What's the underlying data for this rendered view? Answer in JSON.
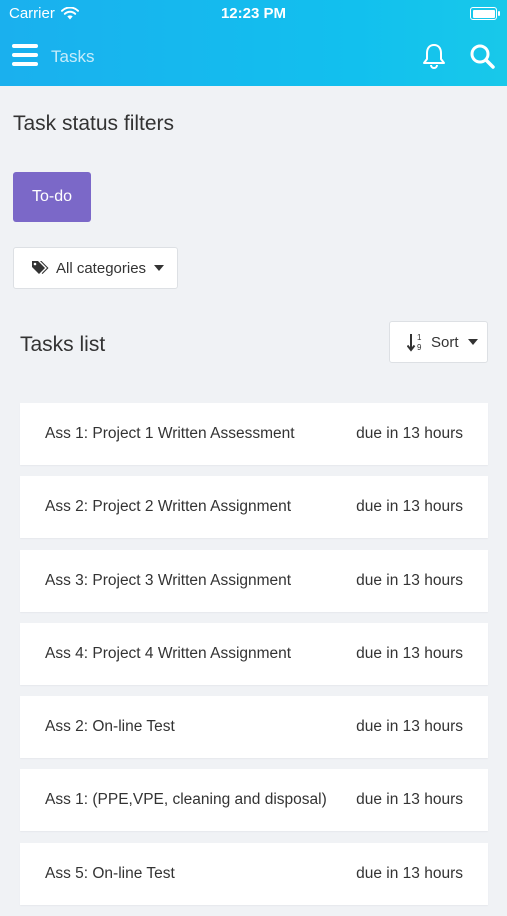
{
  "status_bar": {
    "carrier": "Carrier",
    "time": "12:23 PM",
    "battery_level": 1.0
  },
  "nav": {
    "title": "Tasks",
    "menu_icon": "hamburger-menu-icon",
    "bell_icon": "bell-icon",
    "search_icon": "search-icon"
  },
  "filters": {
    "heading": "Task status filters",
    "status_button": "To-do",
    "category_button": "All categories",
    "category_icon": "tags-icon"
  },
  "tasks": {
    "heading": "Tasks list",
    "sort_button": "Sort",
    "sort_icon": "sort-numeric-icon",
    "items": [
      {
        "name": "Ass 1: Project 1 Written Assessment",
        "due": "due in 13 hours"
      },
      {
        "name": "Ass 2: Project 2 Written Assignment",
        "due": "due in 13 hours"
      },
      {
        "name": "Ass 3: Project 3 Written Assignment",
        "due": "due in 13 hours"
      },
      {
        "name": "Ass 4: Project 4 Written Assignment",
        "due": "due in 13 hours"
      },
      {
        "name": "Ass 2: On-line Test",
        "due": "due in 13 hours"
      },
      {
        "name": "Ass 1: (PPE,VPE, cleaning and disposal)",
        "due": "due in 13 hours"
      },
      {
        "name": "Ass 5: On-line Test",
        "due": "due in 13 hours"
      }
    ]
  },
  "colors": {
    "header": "#1ab0ee",
    "accent_button": "#7b68c8",
    "background": "#f0f2f5"
  }
}
